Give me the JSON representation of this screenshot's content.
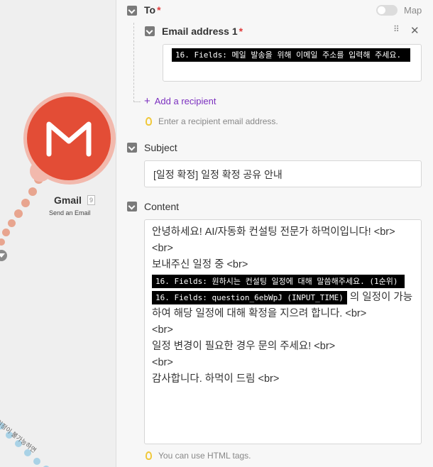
{
  "canvas": {
    "module": {
      "name": "Gmail",
      "number": "9",
      "action": "Send an Email",
      "brand_color": "#e34d36",
      "halo_color": "#f2b9ad"
    },
    "route_label": "일정이 불가능하면"
  },
  "panel": {
    "to": {
      "label": "To",
      "required": "*",
      "map_label": "Map",
      "map_enabled": false
    },
    "email_address": {
      "label": "Email address 1",
      "required": "*",
      "mapped_field": "16. Fields: 메일 발송을 위해 이메일 주소를 입력해 주세요."
    },
    "add_recipient": "Add a recipient",
    "to_hint": "Enter a recipient email address.",
    "subject": {
      "label": "Subject",
      "value": "[일정 확정] 일정 확정 공유 안내"
    },
    "content": {
      "label": "Content",
      "line1": "안녕하세요! AI/자동화 컨설팅 전문가 하먹이입니다! <br>",
      "line2": " <br>",
      "line3": "보내주신 일정 중  <br>",
      "field1": "16. Fields: 원하시는 컨설팅 일정에 대해 말씀해주세요. (1순위)",
      "field2": "16. Fields: question_6ebWpJ (INPUT_TIME)",
      "line4": " 의 일정이 가능하여 해당 일정에 대해 확정을 지으려 합니다.  <br>",
      "line5": " <br>",
      "line6": "일정 변경이 필요한 경우 문의 주세요! <br>",
      "line7": " <br>",
      "line8": "감사합니다. 하먹이 드림 <br>"
    },
    "content_hint": "You can use HTML tags."
  },
  "colors": {
    "accent_purple": "#7b2fbf",
    "required_red": "#e03c3c",
    "hint_bulb": "#f0c83a"
  }
}
